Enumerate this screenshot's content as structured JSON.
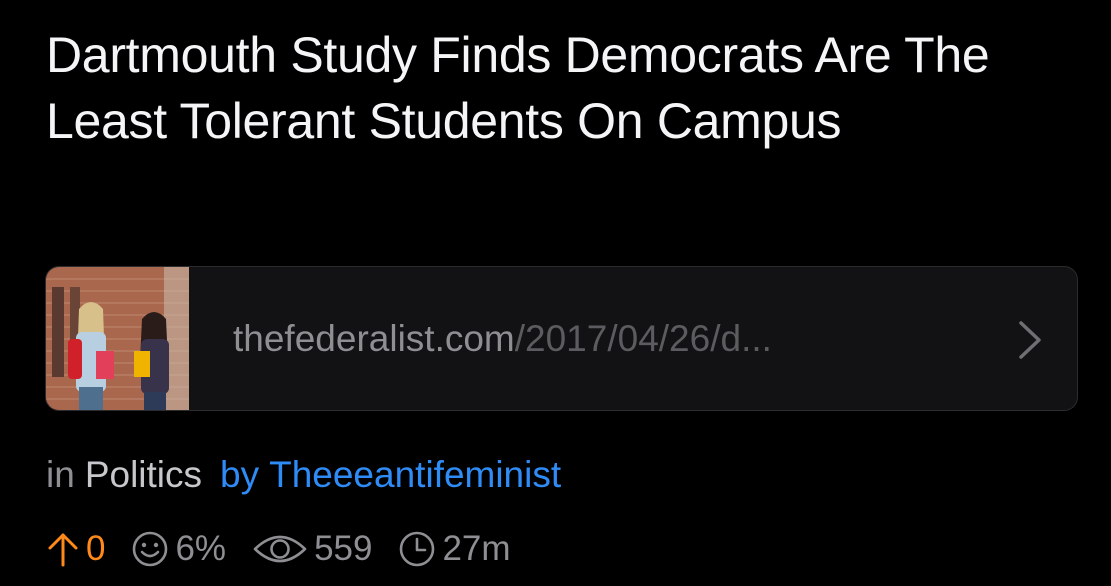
{
  "post": {
    "title": "Dartmouth Study Finds Democrats Are The Least Tolerant Students On Campus",
    "link": {
      "domain": "thefederalist.com",
      "path": "/2017/04/26/d..."
    },
    "meta": {
      "in_label": "in",
      "category": "Politics",
      "by_label": "by",
      "author": "Theeeantifeminist"
    },
    "stats": {
      "upvotes": "0",
      "ratio": "6%",
      "views": "559",
      "age": "27m"
    }
  },
  "colors": {
    "accent_orange": "#ff8a1a",
    "accent_blue": "#2f8bf5",
    "muted_text": "#8e8e93",
    "background": "#000000"
  },
  "icons": {
    "upvote": "arrow-up-icon",
    "ratio": "smiley-icon",
    "views": "eye-icon",
    "age": "clock-icon",
    "open_link": "chevron-right-icon"
  }
}
